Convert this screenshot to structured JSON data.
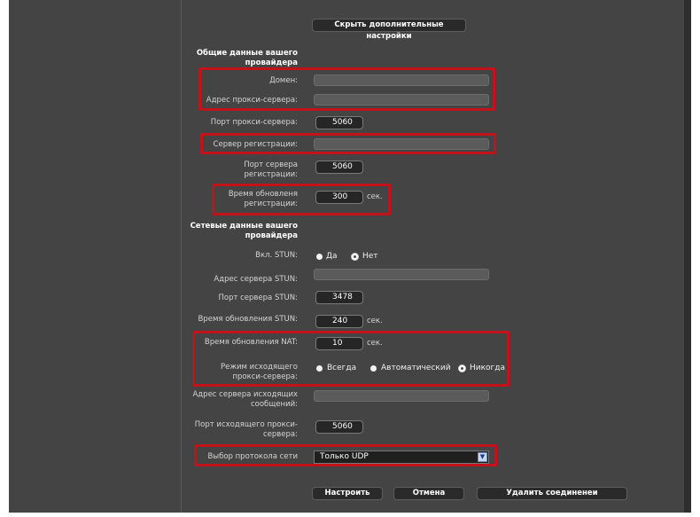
{
  "toggle_button": "Скрыть дополнительные настройки",
  "sections": {
    "provider_general": "Общие данные вашего провайдера",
    "provider_network": "Сетевые данные вашего провайдера"
  },
  "fields": {
    "domain": {
      "label": "Домен:",
      "value": ""
    },
    "proxy_address": {
      "label": "Адрес прокси-сервера:",
      "value": ""
    },
    "proxy_port": {
      "label": "Порт прокси-сервера:",
      "value": "5060"
    },
    "registrar": {
      "label": "Сервер регистрации:",
      "value": ""
    },
    "registrar_port": {
      "label": "Порт сервера регистрации:",
      "value": "5060"
    },
    "reg_refresh": {
      "label": "Время обновленя регистрации:",
      "value": "300",
      "unit": "сек."
    },
    "stun_enable": {
      "label": "Вкл. STUN:",
      "options": [
        "Да",
        "Нет"
      ],
      "selected": "Нет"
    },
    "stun_address": {
      "label": "Адрес сервера STUN:",
      "value": ""
    },
    "stun_port": {
      "label": "Порт сервера STUN:",
      "value": "3478"
    },
    "stun_refresh": {
      "label": "Время обновления STUN:",
      "value": "240",
      "unit": "сек."
    },
    "nat_refresh": {
      "label": "Время обновления NAT:",
      "value": "10",
      "unit": "сек."
    },
    "outbound_mode": {
      "label": "Режим исходящего прокси-сервера:",
      "options": [
        "Всегда",
        "Автоматический",
        "Никогда"
      ],
      "selected": "Никогда"
    },
    "outbound_address": {
      "label": "Адрес сервера исходящих сообщений:",
      "value": ""
    },
    "outbound_port": {
      "label": "Порт исходящего прокси-сервера:",
      "value": "5060"
    },
    "protocol": {
      "label": "Выбор протокола сети",
      "value": "Только UDP"
    }
  },
  "buttons": {
    "configure": "Настроить",
    "cancel": "Отмена",
    "delete": "Удалить соединенеи"
  },
  "colors": {
    "highlight": "#c2131a",
    "panel": "#444444"
  }
}
